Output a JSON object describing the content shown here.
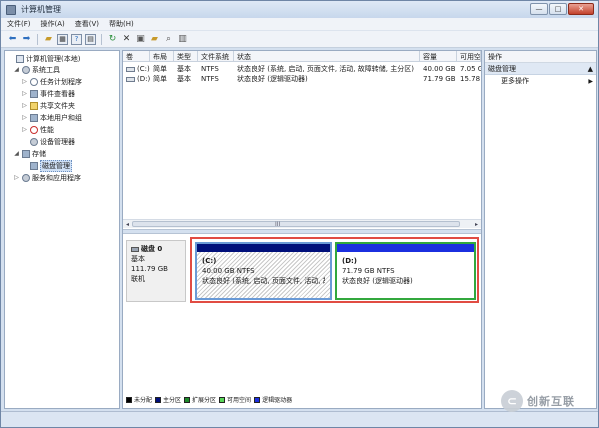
{
  "window": {
    "title": "计算机管理"
  },
  "menu": [
    "文件(F)",
    "操作(A)",
    "查看(V)",
    "帮助(H)"
  ],
  "toolbar": {
    "icons": [
      "back-arrow-icon",
      "forward-arrow-icon",
      "up-folder-icon",
      "show-tree-icon",
      "help-icon",
      "console-icon",
      "refresh-icon",
      "delete-icon",
      "properties-icon",
      "open-icon",
      "find-icon",
      "view-icon"
    ]
  },
  "tree": [
    {
      "label": "计算机管理(本地)",
      "exp": "",
      "icon": "computer"
    },
    {
      "label": "系统工具",
      "exp": "◢",
      "icon": "gear"
    },
    {
      "label": "任务计划程序",
      "exp": "▷",
      "icon": "clock"
    },
    {
      "label": "事件查看器",
      "exp": "▷",
      "icon": "disk"
    },
    {
      "label": "共享文件夹",
      "exp": "▷",
      "icon": "folder"
    },
    {
      "label": "本地用户和组",
      "exp": "▷",
      "icon": "disk"
    },
    {
      "label": "性能",
      "exp": "▷",
      "icon": "red"
    },
    {
      "label": "设备管理器",
      "exp": "",
      "icon": "gear"
    },
    {
      "label": "存储",
      "exp": "◢",
      "icon": "disk"
    },
    {
      "label": "磁盘管理",
      "exp": "",
      "icon": "disk"
    },
    {
      "label": "服务和应用程序",
      "exp": "▷",
      "icon": "gear"
    }
  ],
  "volumes": {
    "headers": [
      "卷",
      "布局",
      "类型",
      "文件系统",
      "状态",
      "容量",
      "可用空"
    ],
    "rows": [
      [
        "(C:)",
        "简单",
        "基本",
        "NTFS",
        "状态良好 (系统, 启动, 页面文件, 活动, 故障转储, 主分区)",
        "40.00 GB",
        "7.05 G"
      ],
      [
        "(D:)",
        "简单",
        "基本",
        "NTFS",
        "状态良好 (逻辑驱动器)",
        "71.79 GB",
        "15.78"
      ]
    ],
    "scroll_grip": "III"
  },
  "disk": {
    "name": "磁盘 0",
    "type": "基本",
    "size": "111.79 GB",
    "status": "联机",
    "partitions": [
      {
        "name": "(C:)",
        "size": "40.00 GB NTFS",
        "status": "状态良好 (系统, 启动, 页面文件, 活动, 故"
      },
      {
        "name": "(D:)",
        "size": "71.79 GB NTFS",
        "status": "状态良好 (逻辑驱动器)"
      }
    ]
  },
  "legend": [
    {
      "label": "未分配",
      "color": "#000000"
    },
    {
      "label": "主分区",
      "color": "#000f7a"
    },
    {
      "label": "扩展分区",
      "color": "#1d8a2a"
    },
    {
      "label": "可用空间",
      "color": "#59d659"
    },
    {
      "label": "逻辑驱动器",
      "color": "#1b2fdf"
    }
  ],
  "actions": {
    "header": "操作",
    "section": "磁盘管理",
    "item": "更多操作"
  },
  "watermark": {
    "text": "创新互联",
    "logo": "⊂"
  }
}
